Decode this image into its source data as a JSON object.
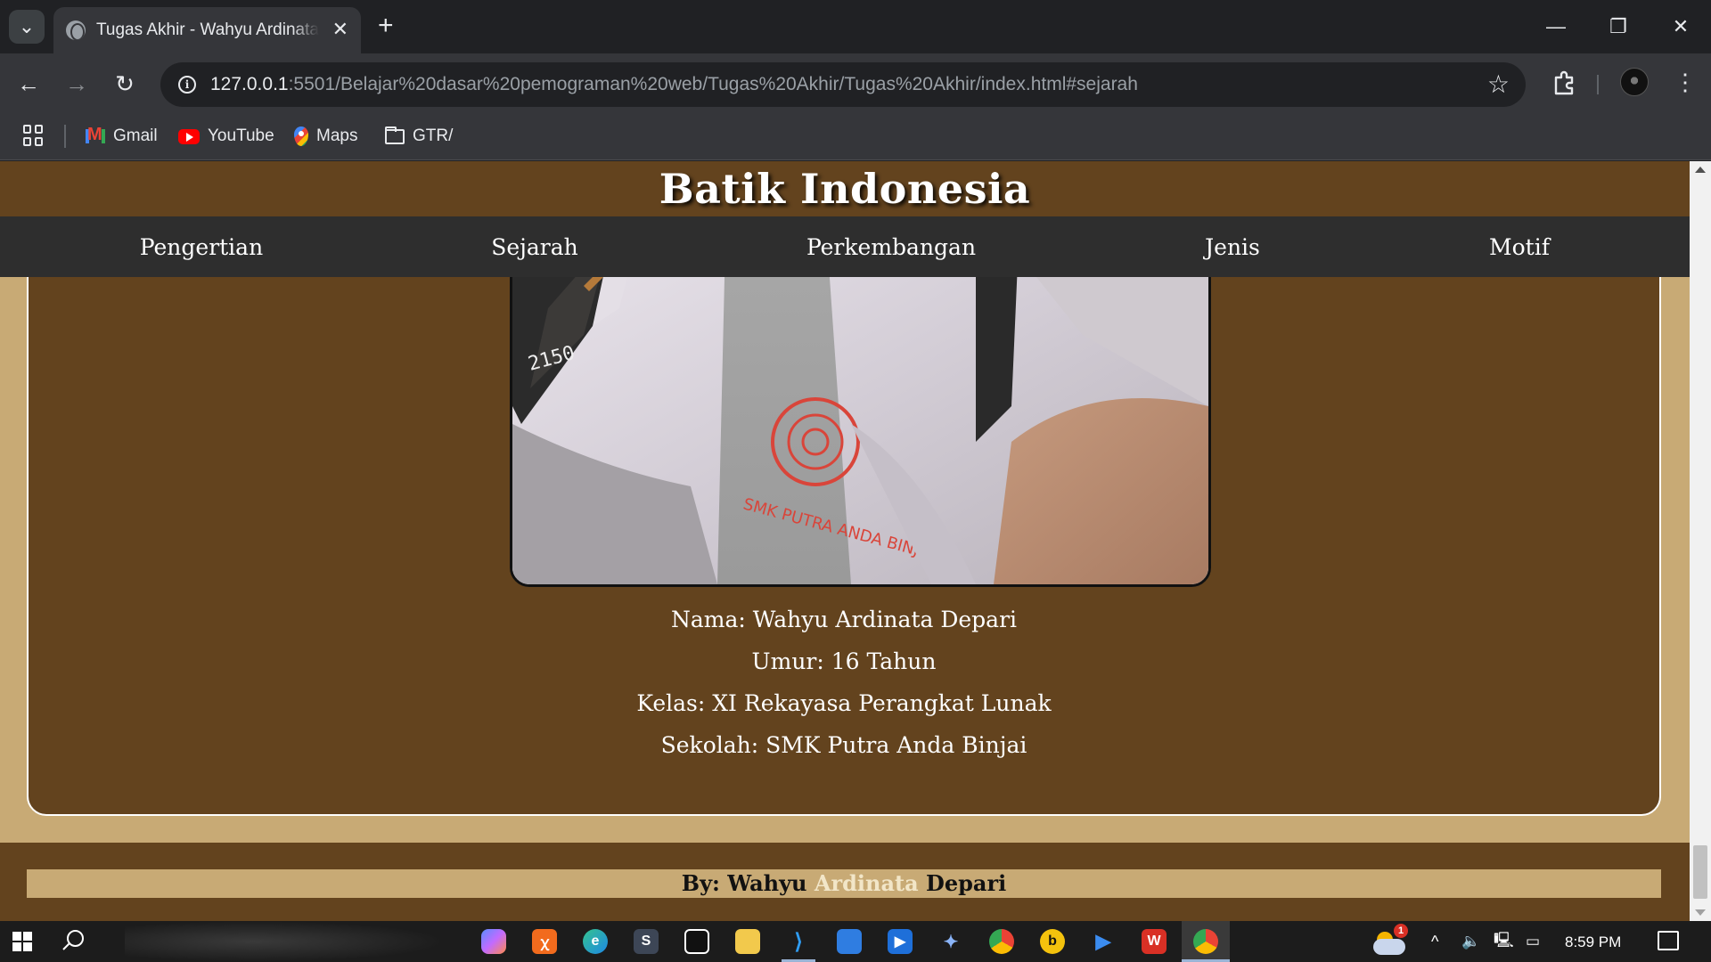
{
  "browser": {
    "tab": {
      "title": "Tugas Akhir - Wahyu Ardinata Depari"
    },
    "url": {
      "host": "127.0.0.1",
      "rest": ":5501/Belajar%20dasar%20pemograman%20web/Tugas%20Akhir/Tugas%20Akhir/index.html#sejarah"
    },
    "bookmarks": [
      {
        "label": "Gmail",
        "icon": "gmail-icon"
      },
      {
        "label": "YouTube",
        "icon": "youtube-icon"
      },
      {
        "label": "Maps",
        "icon": "maps-icon"
      },
      {
        "label": "GTR/",
        "icon": "folder-icon"
      }
    ],
    "icons": {
      "tab_search": "⌄",
      "tab_close": "✕",
      "new_tab": "+",
      "minimize": "—",
      "restore": "❐",
      "close": "✕",
      "back": "←",
      "forward": "→",
      "reload": "↻",
      "star": "☆",
      "menu": "⋮"
    }
  },
  "page": {
    "title": "Batik Indonesia",
    "nav": [
      {
        "label": "Pengertian"
      },
      {
        "label": "Sejarah"
      },
      {
        "label": "Perkembangan"
      },
      {
        "label": "Jenis"
      },
      {
        "label": "Motif"
      }
    ],
    "profile": {
      "photo_stamp_text": "SMK PUTRA ANDA BINJAI",
      "lines": [
        "Nama: Wahyu Ardinata Depari",
        "Umur: 16 Tahun",
        "Kelas: XI Rekayasa Perangkat Lunak",
        "Sekolah: SMK Putra Anda Binjai"
      ]
    },
    "footer": {
      "prefix": "By: Wahyu ",
      "highlight": "Ardinata",
      "suffix": " Depari"
    },
    "colors": {
      "header_brown": "#63431e",
      "tan_background": "#c8aa75",
      "nav_dark": "#2e2e2e"
    }
  },
  "taskbar": {
    "apps": [
      "copilot-icon",
      "xampp-icon",
      "edge-icon",
      "sublime-icon",
      "capcut-icon",
      "file-explorer-icon",
      "vscode-icon",
      "paint-icon",
      "media-player-icon",
      "joystick-icon",
      "chrome-icon",
      "bandicam-icon",
      "play-icon",
      "wps-icon",
      "chrome-active-icon"
    ],
    "weather_badge": "1",
    "clock": "8:59 PM"
  }
}
